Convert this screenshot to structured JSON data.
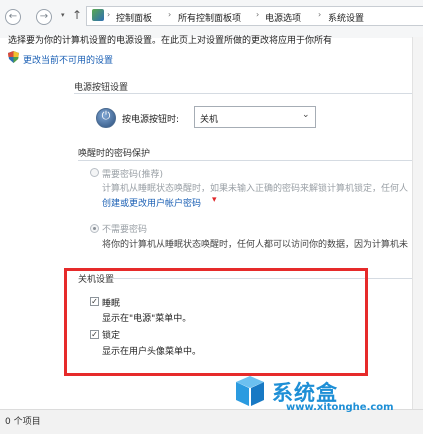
{
  "address_bar": {
    "crumbs": [
      "控制面板",
      "所有控制面板项",
      "电源选项",
      "系统设置"
    ]
  },
  "main": {
    "description": "选择要为你的计算机设置的电源设置。在此页上对设置所做的更改将应用于你所有",
    "change_unavailable_link": "更改当前不可用的设置",
    "power_button_section": {
      "title": "电源按钮设置",
      "label": "按电源按钮时:",
      "selected": "关机"
    },
    "wake_password_section": {
      "title": "唤醒时的密码保护",
      "require": {
        "label": "需要密码(推荐)",
        "desc": "计算机从睡眠状态唤醒时，如果未输入正确的密码来解锁计算机锁定，任何人",
        "link": "创建或更改用户帐户密码",
        "selected": false
      },
      "not_require": {
        "label": "不需要密码",
        "desc": "将你的计算机从睡眠状态唤醒时，任何人都可以访问你的数据，因为计算机未",
        "selected": true
      }
    },
    "shutdown_section": {
      "title": "关机设置",
      "items": [
        {
          "label": "睡眠",
          "desc": "显示在\"电源\"菜单中。",
          "checked": true
        },
        {
          "label": "锁定",
          "desc": "显示在用户头像菜单中。",
          "checked": true
        }
      ]
    }
  },
  "status_bar": {
    "text": "0 个项目"
  },
  "watermark": {
    "brand": "系统盒",
    "url": "www.xitonghe.com"
  },
  "colors": {
    "link": "#1a5fb4",
    "highlight_border": "#e62a2a",
    "watermark": "#1e8fd6"
  }
}
